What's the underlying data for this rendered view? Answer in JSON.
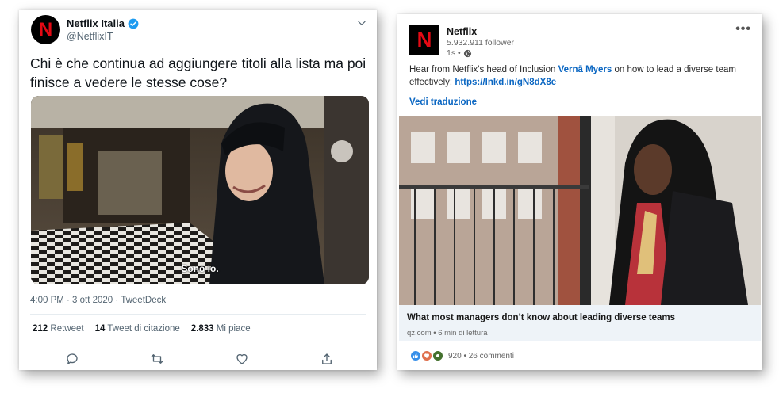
{
  "twitter": {
    "display_name": "Netflix Italia",
    "handle": "@NetflixIT",
    "logo_letter": "N",
    "tweet_text": "Chi è che continua ad aggiungere titoli alla lista ma poi finisce a vedere le stesse cose?",
    "subtitle": "Sono io.",
    "timestamp": "4:00 PM · 3 ott 2020 · TweetDeck",
    "stats": {
      "retweets_count": "212",
      "retweets_label": "Retweet",
      "quotes_count": "14",
      "quotes_label": "Tweet di citazione",
      "likes_count": "2.833",
      "likes_label": "Mi piace"
    }
  },
  "linkedin": {
    "company": "Netflix",
    "logo_letter": "N",
    "followers": "5.932.911 follower",
    "time": "1s •",
    "post_text_1": "Hear from Netflix's head of Inclusion ",
    "mention": "Vernā Myers",
    "post_text_2": " on how to lead a diverse team effectively: ",
    "link": "https://lnkd.in/gN8dX8e",
    "translate_label": "Vedi traduzione",
    "article_title": "What most managers don’t know about leading diverse teams",
    "article_source": "qz.com • 6 min di lettura",
    "reactions_summary": "920 • 26 commenti"
  },
  "colors": {
    "netflix_red": "#e50914",
    "twitter_blue": "#1d9bf0",
    "linkedin_blue": "#0a66c2"
  }
}
